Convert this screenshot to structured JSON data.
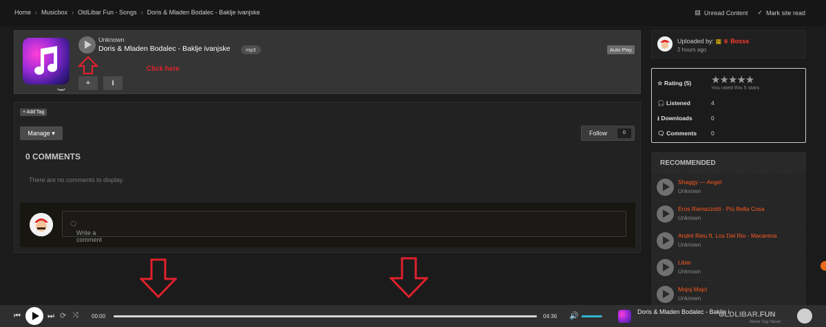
{
  "breadcrumb": [
    "Home",
    "Musicbox",
    "OldLibar Fun - Songs",
    "Doris & Mladen Bodalec - Baklje ivanjske"
  ],
  "top_links": {
    "unread": "Unread Content",
    "mark_read": "Mark site read"
  },
  "player": {
    "artist": "Unknown",
    "title": "Doris & Mladen Bodalec - Baklje ivanjske",
    "format": "mp3",
    "autoplay_label": "Auto Play",
    "add_label": "+",
    "annotation": "Click here"
  },
  "comments": {
    "add_tag": "+ Add Tag",
    "manage": "Manage ▾",
    "follow": "Follow",
    "follow_count": "0",
    "heading": "0 COMMENTS",
    "empty": "There are no comments to display.",
    "placeholder": "Write a comment"
  },
  "uploader": {
    "label": "Uploaded by:",
    "name": "Bosss",
    "time": "2 hours ago"
  },
  "stats": {
    "rating_label": "Rating (5)",
    "rated_note": "You rated this 5 stars",
    "listened_label": "Listened",
    "listened": "4",
    "downloads_label": "Downloads",
    "downloads": "0",
    "comments_label": "Comments",
    "comments": "0"
  },
  "recommended": {
    "heading": "RECOMMENDED",
    "items": [
      {
        "title": "Shaggy — Angel",
        "artist": "Unknown"
      },
      {
        "title": "Eros Ramazzotti - Più Bella Cosa",
        "artist": "Unknown"
      },
      {
        "title": "André Rieu ft. Los Del Rio - Macarena",
        "artist": "Unknown"
      },
      {
        "title": "Libar",
        "artist": "Unknown"
      },
      {
        "title": "Mojoj Majci",
        "artist": "Unknown"
      }
    ]
  },
  "bottom_player": {
    "elapsed": "00:00",
    "duration": "04:36",
    "title": "Doris & Mladen Bodalec - Baklje i",
    "logo_a": "OLDLIBAR.",
    "logo_b": "FUN",
    "tagline": "Never Say Never",
    "volume_fraction": 0.95
  },
  "colors": {
    "accent": "#ff5a22",
    "annotation": "#e0212b",
    "volume": "#31b6d6"
  }
}
